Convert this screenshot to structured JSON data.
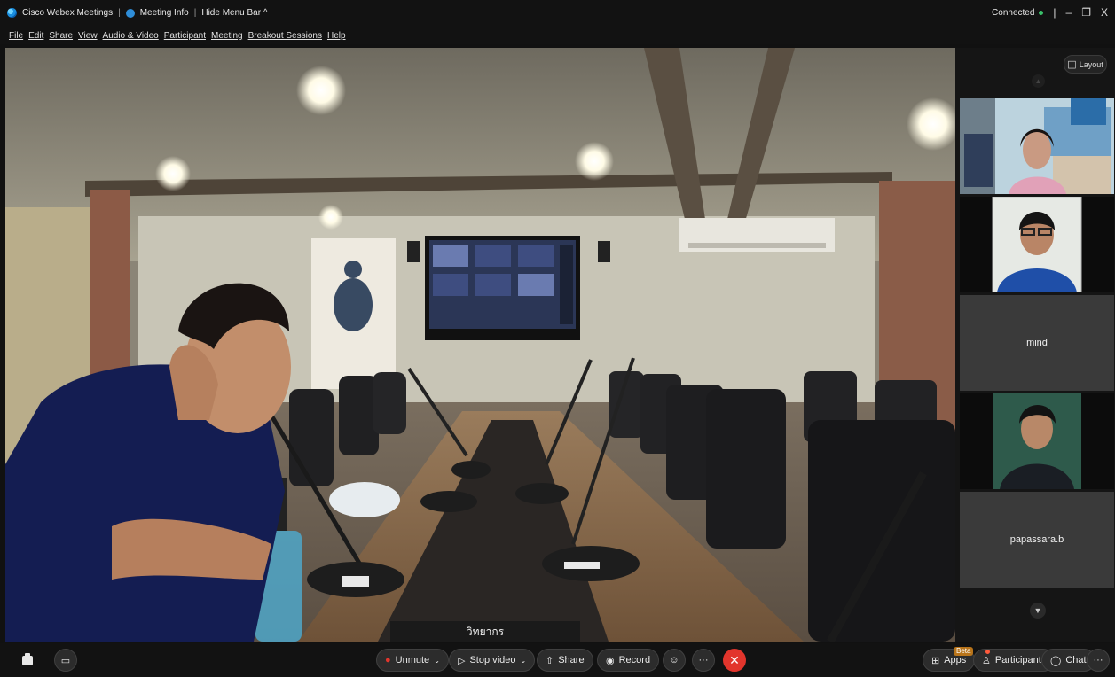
{
  "window": {
    "app_name": "Cisco Webex Meetings",
    "meeting_info_label": "Meeting Info",
    "hide_menu_bar_label": "Hide Menu Bar ^",
    "status_text": "Connected",
    "minimize_glyph": "–",
    "restore_glyph": "❐",
    "close_glyph": "X"
  },
  "menu": {
    "items": [
      {
        "label": "File"
      },
      {
        "label": "Edit"
      },
      {
        "label": "Share"
      },
      {
        "label": "View"
      },
      {
        "label": "Audio & Video"
      },
      {
        "label": "Participant"
      },
      {
        "label": "Meeting"
      },
      {
        "label": "Breakout Sessions"
      },
      {
        "label": "Help"
      }
    ]
  },
  "main_video": {
    "speaker_name": "วิทยากร"
  },
  "sidebar": {
    "layout_label": "Layout",
    "participants": [
      {
        "name": "",
        "has_video": true
      },
      {
        "name": "",
        "has_video": true
      },
      {
        "name": "mind",
        "has_video": false
      },
      {
        "name": "",
        "has_video": true
      },
      {
        "name": "papassara.b",
        "has_video": false
      }
    ]
  },
  "controls": {
    "unmute_label": "Unmute",
    "stop_video_label": "Stop video",
    "share_label": "Share",
    "record_label": "Record",
    "more_glyph": "···",
    "end_glyph": "✕",
    "apps_label": "Apps",
    "apps_badge": "Beta",
    "participants_label": "Participants",
    "chat_label": "Chat"
  },
  "colors": {
    "end_call": "#e2352c",
    "muted_icon": "#e2352c",
    "connected": "#3ac06a",
    "beta_badge": "#b8741a"
  }
}
